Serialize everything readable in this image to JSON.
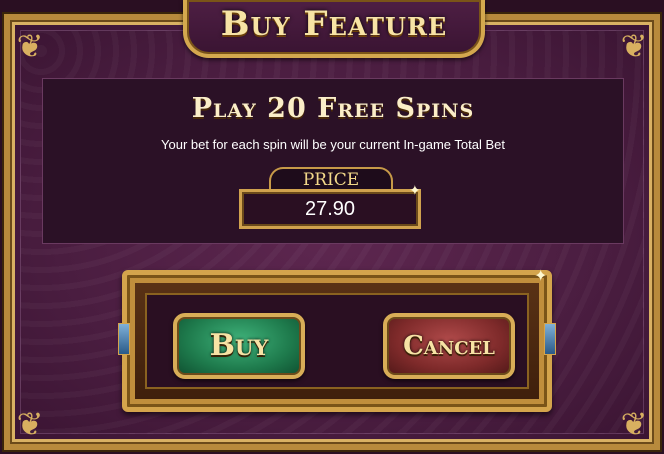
{
  "title": "Buy Feature",
  "offer": {
    "headline": "Play 20 Free Spins",
    "description": "Your bet for each spin will be your current In-game Total Bet"
  },
  "price": {
    "label": "PRICE",
    "value": "27.90"
  },
  "buttons": {
    "buy_label": "Buy",
    "cancel_label": "Cancel"
  },
  "colors": {
    "background": "#4a1d40",
    "gold": "#d4a84e",
    "buy_green": "#1e7a4c",
    "cancel_red": "#7e2a2a"
  },
  "icons": [
    "corner-ornament-icon",
    "sparkle-icon"
  ]
}
